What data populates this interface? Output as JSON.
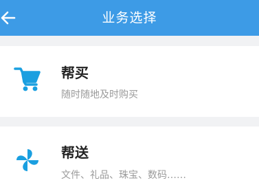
{
  "header": {
    "title": "业务选择"
  },
  "icons": {
    "back": "arrow-left-icon",
    "buy": "shopping-cart-icon",
    "send": "pinwheel-icon"
  },
  "colors": {
    "header_bg": "#3d9be6",
    "icon": "#1a9fe0"
  },
  "services": [
    {
      "title": "帮买",
      "subtitle": "随时随地及时购买"
    },
    {
      "title": "帮送",
      "subtitle": "文件、礼品、珠宝、数码……"
    }
  ]
}
